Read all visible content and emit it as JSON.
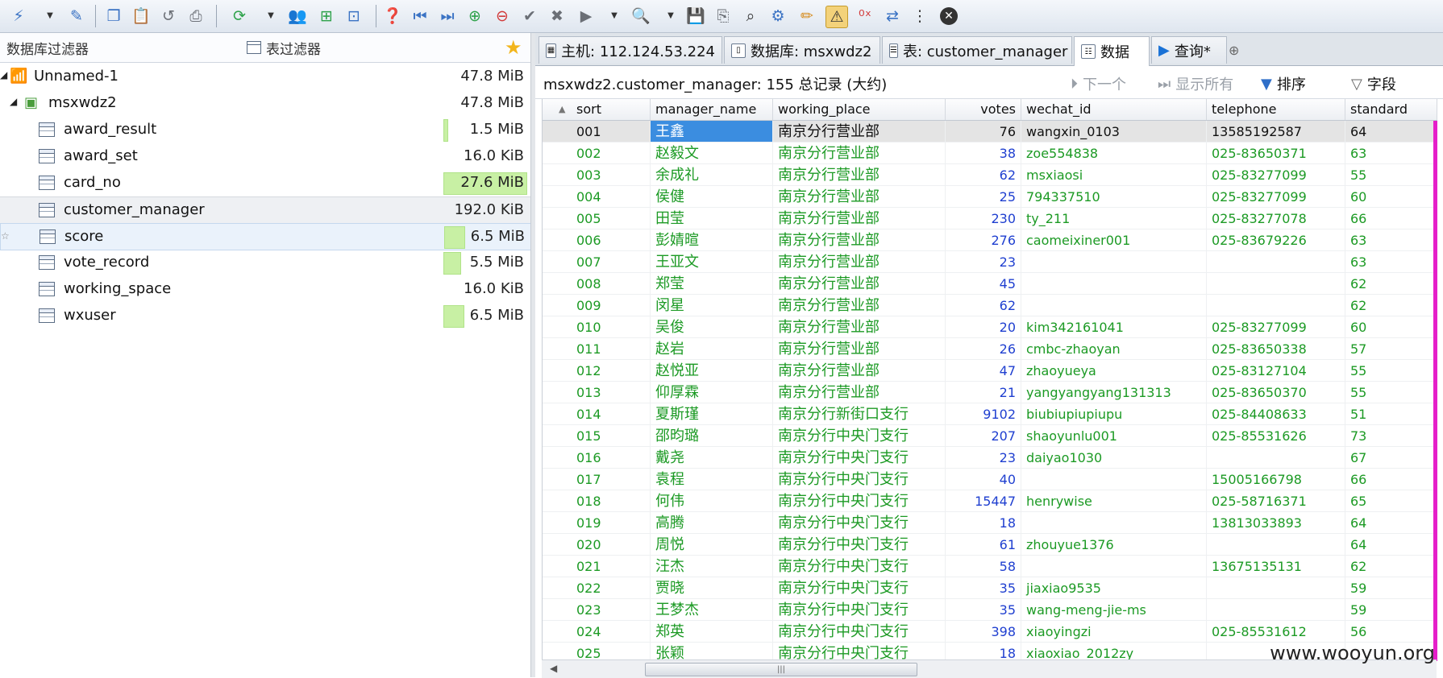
{
  "toolbar": {
    "icons": [
      "connect-icon",
      "connect-dropdown",
      "disconnect-icon",
      "copy-icon",
      "paste-icon",
      "undo-icon",
      "print-icon",
      "refresh-icon",
      "refresh-dropdown",
      "user-manager-icon",
      "import-icon",
      "export-icon",
      "help-icon",
      "first-record-icon",
      "last-record-icon",
      "insert-row-icon",
      "delete-row-icon",
      "apply-icon",
      "cancel-icon",
      "run-icon",
      "run-dropdown",
      "find-icon",
      "find-dropdown",
      "save-icon",
      "save-as-icon",
      "binoculars-icon",
      "sql-icon",
      "edit-icon",
      "warning-icon",
      "hex-icon",
      "swap-icon",
      "more-icon",
      "close-icon"
    ]
  },
  "filters": {
    "db_filter": "数据库过滤器",
    "table_filter": "表过滤器"
  },
  "tree": {
    "items": [
      {
        "name": "Unnamed-1",
        "size": "47.8 MiB",
        "level": 0,
        "bar": 0
      },
      {
        "name": "msxwdz2",
        "size": "47.8 MiB",
        "level": 1,
        "bar": 0
      },
      {
        "name": "award_result",
        "size": "1.5 MiB",
        "level": 2,
        "bar": 0.05
      },
      {
        "name": "award_set",
        "size": "16.0 KiB",
        "level": 2,
        "bar": 0
      },
      {
        "name": "card_no",
        "size": "27.6 MiB",
        "level": 2,
        "bar": 1
      },
      {
        "name": "customer_manager",
        "size": "192.0 KiB",
        "level": 2,
        "bar": 0
      },
      {
        "name": "score",
        "size": "6.5 MiB",
        "level": 2,
        "bar": 0.25
      },
      {
        "name": "vote_record",
        "size": "5.5 MiB",
        "level": 2,
        "bar": 0.22
      },
      {
        "name": "working_space",
        "size": "16.0 KiB",
        "level": 2,
        "bar": 0
      },
      {
        "name": "wxuser",
        "size": "6.5 MiB",
        "level": 2,
        "bar": 0.25
      }
    ]
  },
  "tabs": [
    {
      "label": "主机: 112.124.53.224"
    },
    {
      "label": "数据库: msxwdz2"
    },
    {
      "label": "表: customer_manager"
    },
    {
      "label": "数据"
    },
    {
      "label": "查询*"
    }
  ],
  "infobar": {
    "summary": "msxwdz2.customer_manager: 155 总记录 (大约)",
    "next": "下一个",
    "show_all": "显示所有",
    "sort": "排序",
    "fields": "字段"
  },
  "grid": {
    "columns": [
      "sort",
      "manager_name",
      "working_place",
      "votes",
      "wechat_id",
      "telephone",
      "standard"
    ],
    "rows": [
      [
        "001",
        "王鑫",
        "南京分行营业部",
        "76",
        "wangxin_0103",
        "13585192587",
        "64"
      ],
      [
        "002",
        "赵毅文",
        "南京分行营业部",
        "38",
        "zoe554838",
        "025-83650371",
        "63"
      ],
      [
        "003",
        "余成礼",
        "南京分行营业部",
        "62",
        "msxiaosi",
        "025-83277099",
        "55"
      ],
      [
        "004",
        "侯健",
        "南京分行营业部",
        "25",
        "794337510",
        "025-83277099",
        "60"
      ],
      [
        "005",
        "田莹",
        "南京分行营业部",
        "230",
        "ty_211",
        "025-83277078",
        "66"
      ],
      [
        "006",
        "彭婧暄",
        "南京分行营业部",
        "276",
        "caomeixiner001",
        "025-83679226",
        "63"
      ],
      [
        "007",
        "王亚文",
        "南京分行营业部",
        "23",
        "",
        "",
        "63"
      ],
      [
        "008",
        "郑莹",
        "南京分行营业部",
        "45",
        "",
        "",
        "62"
      ],
      [
        "009",
        "闵星",
        "南京分行营业部",
        "62",
        "",
        "",
        "62"
      ],
      [
        "010",
        "吴俊",
        "南京分行营业部",
        "20",
        "kim342161041",
        "025-83277099",
        "60"
      ],
      [
        "011",
        "赵岩",
        "南京分行营业部",
        "26",
        "cmbc-zhaoyan",
        "025-83650338",
        "57"
      ],
      [
        "012",
        "赵悦亚",
        "南京分行营业部",
        "47",
        "zhaoyueya",
        "025-83127104",
        "55"
      ],
      [
        "013",
        "仰厚霖",
        "南京分行营业部",
        "21",
        "yangyangyang131313",
        "025-83650370",
        "55"
      ],
      [
        "014",
        "夏斯瑾",
        "南京分行新街口支行",
        "9102",
        "biubiupiupiupu",
        "025-84408633",
        "51"
      ],
      [
        "015",
        "邵昀璐",
        "南京分行中央门支行",
        "207",
        "shaoyunlu001",
        "025-85531626",
        "73"
      ],
      [
        "016",
        "戴尧",
        "南京分行中央门支行",
        "23",
        "daiyao1030",
        "",
        "67"
      ],
      [
        "017",
        "袁程",
        "南京分行中央门支行",
        "40",
        "",
        "15005166798",
        "66"
      ],
      [
        "018",
        "何伟",
        "南京分行中央门支行",
        "15447",
        "henrywise",
        "025-58716371",
        "65"
      ],
      [
        "019",
        "高腾",
        "南京分行中央门支行",
        "18",
        "",
        "13813033893",
        "64"
      ],
      [
        "020",
        "周悦",
        "南京分行中央门支行",
        "61",
        "zhouyue1376",
        "",
        "64"
      ],
      [
        "021",
        "汪杰",
        "南京分行中央门支行",
        "58",
        "",
        "13675135131",
        "62"
      ],
      [
        "022",
        "贾晓",
        "南京分行中央门支行",
        "35",
        "jiaxiao9535",
        "",
        "59"
      ],
      [
        "023",
        "王梦杰",
        "南京分行中央门支行",
        "35",
        "wang-meng-jie-ms",
        "",
        "59"
      ],
      [
        "024",
        "郑英",
        "南京分行中央门支行",
        "398",
        "xiaoyingzi",
        "025-85531612",
        "56"
      ],
      [
        "025",
        "张颖",
        "南京分行中央门支行",
        "18",
        "xiaoxiao_2012zy",
        "",
        ""
      ]
    ]
  },
  "watermark": "www.wooyun.org"
}
